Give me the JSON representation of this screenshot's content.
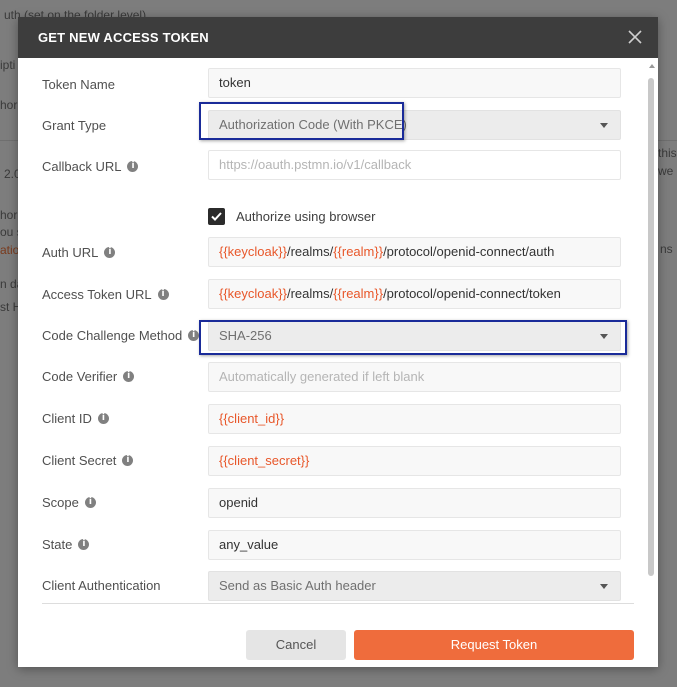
{
  "background": {
    "fragments": [
      "uth (set on the folder level)",
      "ipti",
      "hor",
      "2.0",
      "hork",
      "ou s",
      "atio",
      "n da",
      "st H",
      "this",
      "we",
      "ns"
    ]
  },
  "modal": {
    "title": "GET NEW ACCESS TOKEN",
    "close_icon": "close-icon"
  },
  "form": {
    "token_name": {
      "label": "Token Name",
      "value": "token"
    },
    "grant_type": {
      "label": "Grant Type",
      "value": "Authorization Code (With PKCE)"
    },
    "callback_url": {
      "label": "Callback URL",
      "placeholder": "https://oauth.pstmn.io/v1/callback"
    },
    "authorize_browser": {
      "label": "Authorize using browser",
      "checked": true
    },
    "auth_url": {
      "label": "Auth URL",
      "parts": [
        "{{keycloak}}",
        "/realms/",
        "{{realm}}",
        "/protocol/openid-connect/auth"
      ]
    },
    "access_token_url": {
      "label": "Access Token URL",
      "parts": [
        "{{keycloak}}",
        "/realms/",
        "{{realm}}",
        "/protocol/openid-connect/token"
      ]
    },
    "code_challenge_method": {
      "label": "Code Challenge Method",
      "value": "SHA-256"
    },
    "code_verifier": {
      "label": "Code Verifier",
      "placeholder": "Automatically generated if left blank"
    },
    "client_id": {
      "label": "Client ID",
      "value": "{{client_id}}"
    },
    "client_secret": {
      "label": "Client Secret",
      "value": "{{client_secret}}"
    },
    "scope": {
      "label": "Scope",
      "value": "openid"
    },
    "state": {
      "label": "State",
      "value": "any_value"
    },
    "client_authentication": {
      "label": "Client Authentication",
      "value": "Send as Basic Auth header"
    }
  },
  "buttons": {
    "cancel": "Cancel",
    "request_token": "Request Token"
  },
  "colors": {
    "header_bg": "#3d3d3d",
    "accent": "#ef6c3c",
    "variable_text": "#e8572a",
    "highlight_border": "#1a2b99"
  }
}
